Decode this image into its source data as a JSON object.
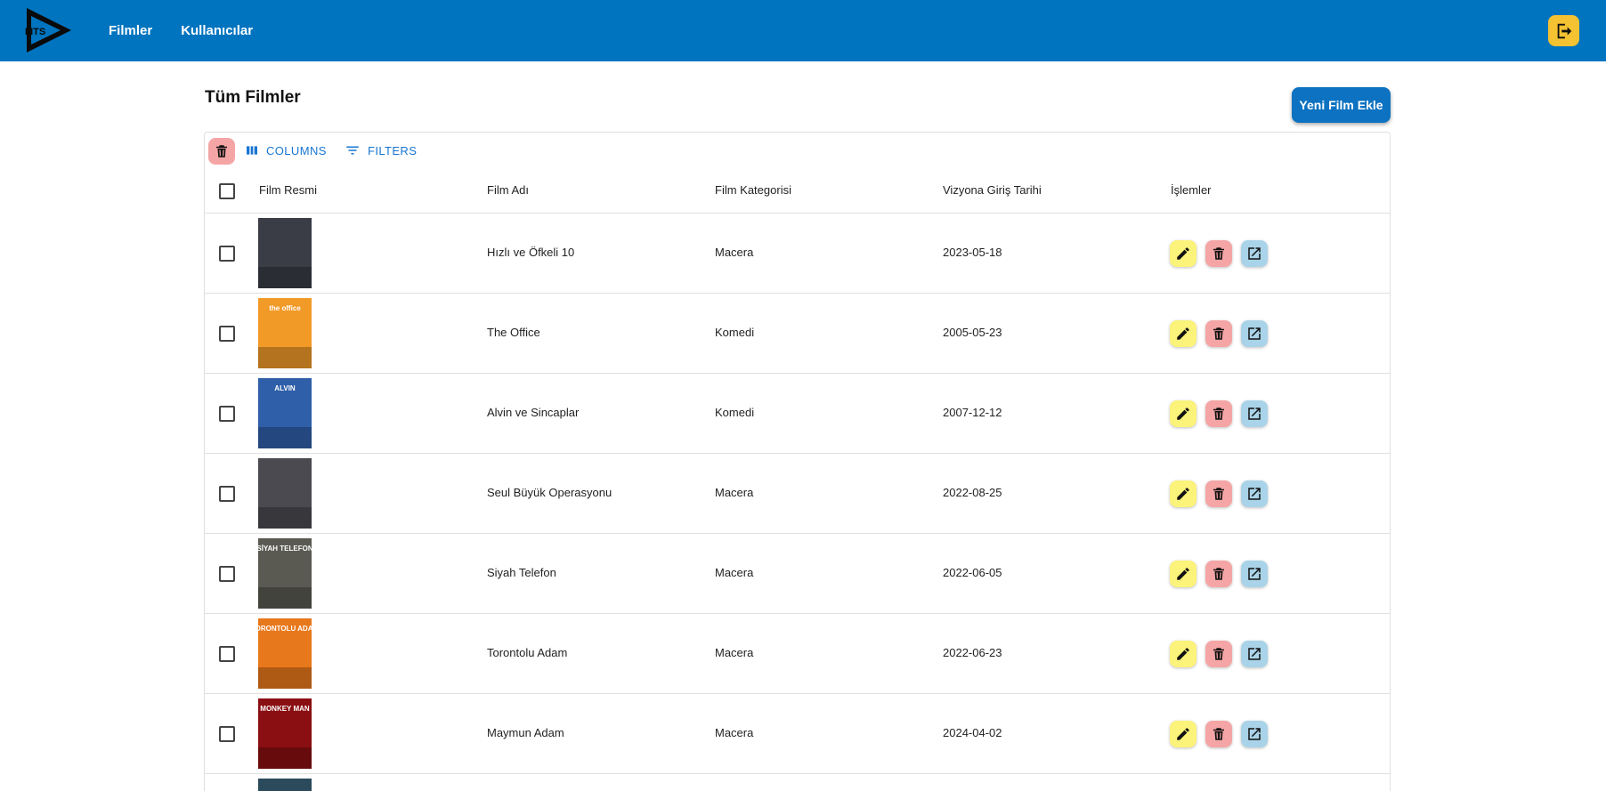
{
  "app": {
    "logo_text": "MTS",
    "nav": [
      "Filmler",
      "Kullanıcılar"
    ]
  },
  "page": {
    "title": "Tüm Filmler",
    "add_button": "Yeni Film Ekle"
  },
  "toolbar": {
    "columns_label": "COLUMNS",
    "filters_label": "FILTERS"
  },
  "table": {
    "columns": [
      "Film Resmi",
      "Film Adı",
      "Film Kategorisi",
      "Vizyona Giriş Tarihi",
      "İşlemler"
    ],
    "rows": [
      {
        "name": "Hızlı ve Öfkeli 10",
        "category": "Macera",
        "date": "2023-05-18"
      },
      {
        "name": "The Office",
        "category": "Komedi",
        "date": "2005-05-23"
      },
      {
        "name": "Alvin ve Sincaplar",
        "category": "Komedi",
        "date": "2007-12-12"
      },
      {
        "name": "Seul Büyük Operasyonu",
        "category": "Macera",
        "date": "2022-08-25"
      },
      {
        "name": "Siyah Telefon",
        "category": "Macera",
        "date": "2022-06-05"
      },
      {
        "name": "Torontolu Adam",
        "category": "Macera",
        "date": "2022-06-23"
      },
      {
        "name": "Maymun Adam",
        "category": "Macera",
        "date": "2024-04-02"
      }
    ]
  },
  "posters": [
    {
      "text": "",
      "bg": "#3a3d46"
    },
    {
      "text": "the office",
      "bg": "#f19a28"
    },
    {
      "text": "ALVIN",
      "bg": "#2f5fa8"
    },
    {
      "text": "",
      "bg": "#4a4a50"
    },
    {
      "text": "SİYAH TELEFON",
      "bg": "#5a5a52"
    },
    {
      "text": "TORONTOLU ADAM",
      "bg": "#e8781c"
    },
    {
      "text": "MONKEY MAN",
      "bg": "#8a0f12"
    }
  ],
  "colors": {
    "primary": "#0074bf",
    "accent": "#f5c232",
    "edit": "#fbf37a",
    "delete": "#f5a5a5",
    "open": "#a9d3e8"
  },
  "icons": [
    "logout-icon",
    "trash-icon",
    "columns-icon",
    "filter-icon",
    "edit-icon",
    "open-in-new-icon"
  ]
}
